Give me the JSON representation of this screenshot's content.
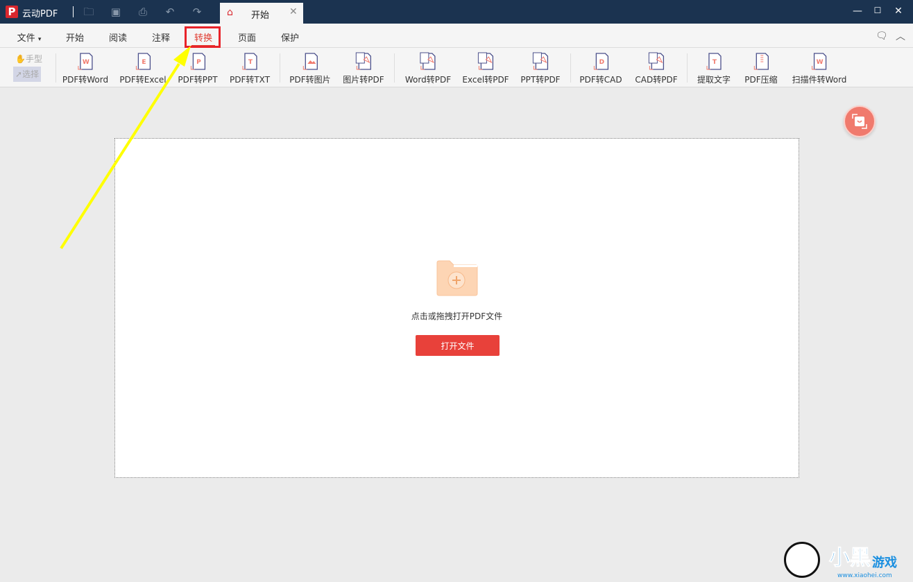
{
  "app": {
    "name": "云动PDF",
    "logo_letter": "P"
  },
  "quick_access": [
    "open-folder-icon",
    "save-icon",
    "print-icon",
    "undo-icon",
    "redo-icon"
  ],
  "doc_tab": {
    "label": "开始"
  },
  "menu": {
    "items": [
      "文件",
      "开始",
      "阅读",
      "注释",
      "转换",
      "页面",
      "保护"
    ],
    "active": "转换",
    "file_caret": "▾"
  },
  "modes": {
    "hand": "手型",
    "select": "选择"
  },
  "toolbar": {
    "items": [
      {
        "label": "PDF转Word",
        "glyph": "W"
      },
      {
        "label": "PDF转Excel",
        "glyph": "E"
      },
      {
        "label": "PDF转PPT",
        "glyph": "P"
      },
      {
        "label": "PDF转TXT",
        "glyph": "T"
      },
      {
        "label": "PDF转图片",
        "glyph": "img"
      },
      {
        "label": "图片转PDF",
        "glyph": "pdf"
      },
      {
        "label": "Word转PDF",
        "glyph": "pdf"
      },
      {
        "label": "Excel转PDF",
        "glyph": "pdf"
      },
      {
        "label": "PPT转PDF",
        "glyph": "pdf"
      },
      {
        "label": "PDF转CAD",
        "glyph": "D"
      },
      {
        "label": "CAD转PDF",
        "glyph": "pdf"
      },
      {
        "label": "提取文字",
        "glyph": "T"
      },
      {
        "label": "PDF压缩",
        "glyph": "zip"
      },
      {
        "label": "扫描件转Word",
        "glyph": "W"
      }
    ]
  },
  "main": {
    "prompt": "点击或拖拽打开PDF文件",
    "open_button": "打开文件"
  },
  "watermark": {
    "text": "小黑游戏",
    "url": "www.xiaohei.com"
  },
  "colors": {
    "titlebar": "#1b3350",
    "accent": "#e8413a",
    "annotation_arrow": "#ffff00",
    "highlight_box": "#e8232a"
  }
}
